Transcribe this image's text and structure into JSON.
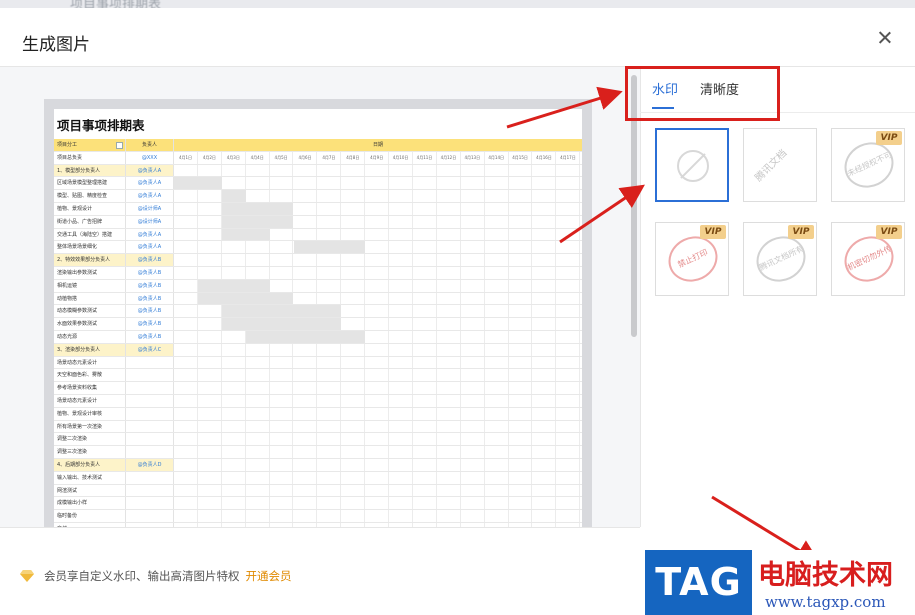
{
  "background": {
    "blurred_title": "项目事项排期表"
  },
  "dialog": {
    "title": "生成图片"
  },
  "sheet": {
    "title": "项目事项排期表",
    "header": {
      "name": "项目分工",
      "owner": "负责人",
      "dates": "日期"
    },
    "date_labels": [
      "4月1日",
      "4月2日",
      "4月3日",
      "4月4日",
      "4月5日",
      "4月6日",
      "4月7日",
      "4月8日",
      "4月9日",
      "4月10日",
      "4月11日",
      "4月12日",
      "4月13日",
      "4月14日",
      "4月15日",
      "4月16日",
      "4月17日"
    ],
    "rows": [
      {
        "name": "项目总负责",
        "owner": "@XXX",
        "section": false
      },
      {
        "name": "1、模型部分负责人",
        "owner": "@负责人A",
        "section": true
      },
      {
        "name": "区域场景模型整理搭建",
        "owner": "@负责人A",
        "section": false
      },
      {
        "name": "模型、贴图、精度检查",
        "owner": "@负责人A",
        "section": false
      },
      {
        "name": "植物、景观设计",
        "owner": "@设计师A",
        "section": false
      },
      {
        "name": "街道小品、广告招牌",
        "owner": "@设计师A",
        "section": false
      },
      {
        "name": "交通工具（海陆空）搭建",
        "owner": "@负责人A",
        "section": false
      },
      {
        "name": "整体场景场景细化",
        "owner": "@负责人A",
        "section": false
      },
      {
        "name": "2、特效效果部分负责人",
        "owner": "@负责人B",
        "section": true
      },
      {
        "name": "渲染输出参数测试",
        "owner": "@负责人B",
        "section": false
      },
      {
        "name": "相机运镜",
        "owner": "@负责人B",
        "section": false
      },
      {
        "name": "动植物搭",
        "owner": "@负责人B",
        "section": false
      },
      {
        "name": "动态模糊参数测试",
        "owner": "@负责人B",
        "section": false
      },
      {
        "name": "水面效果参数测试",
        "owner": "@负责人B",
        "section": false
      },
      {
        "name": "动态光源",
        "owner": "@负责人B",
        "section": false
      },
      {
        "name": "3、渲染部分负责人",
        "owner": "@负责人C",
        "section": true
      },
      {
        "name": "场景动态元素设计",
        "owner": "",
        "section": false
      },
      {
        "name": "天空和面色彩、雾散",
        "owner": "",
        "section": false
      },
      {
        "name": "参考场景资料收集",
        "owner": "",
        "section": false
      },
      {
        "name": "场景动态元素设计",
        "owner": "",
        "section": false
      },
      {
        "name": "植物、景观设计审核",
        "owner": "",
        "section": false
      },
      {
        "name": "所有场景第一次渲染",
        "owner": "",
        "section": false
      },
      {
        "name": "调整二次渲染",
        "owner": "",
        "section": false
      },
      {
        "name": "调整三次渲染",
        "owner": "",
        "section": false
      },
      {
        "name": "4、后期部分负责人",
        "owner": "@负责人D",
        "section": true
      },
      {
        "name": "输入输出、技术测试",
        "owner": "",
        "section": false
      },
      {
        "name": "网渲测试",
        "owner": "",
        "section": false
      },
      {
        "name": "成模输出小样",
        "owner": "",
        "section": false
      },
      {
        "name": "临时备份",
        "owner": "",
        "section": false
      },
      {
        "name": "交付",
        "owner": "",
        "section": false
      }
    ]
  },
  "panel": {
    "tabs": [
      {
        "label": "水印",
        "active": true
      },
      {
        "label": "清晰度",
        "active": false
      }
    ],
    "watermarks": [
      {
        "type": "none",
        "vip": false,
        "text": "",
        "selected": true
      },
      {
        "type": "text-tile",
        "vip": false,
        "text": "腾讯文档",
        "selected": false
      },
      {
        "type": "stamp",
        "vip": true,
        "text": "未经授权不可",
        "selected": false
      },
      {
        "type": "stamp-red",
        "vip": true,
        "text": "禁止打印",
        "selected": false
      },
      {
        "type": "stamp",
        "vip": true,
        "text": "腾讯文档所有",
        "selected": false
      },
      {
        "type": "stamp-red",
        "vip": true,
        "text": "机密切勿外传",
        "selected": false
      }
    ],
    "vip_label": "VIP"
  },
  "footer": {
    "text": "会员享自定义水印、输出高清图片特权",
    "link": "开通会员"
  },
  "logo": {
    "tag": "TAG",
    "cn": "电脑技术网",
    "url": "www.tagxp.com"
  },
  "colors": {
    "accent": "#2b6fd6",
    "annotation": "#d9201c",
    "vip_bg": "#f3cf8c",
    "link": "#e08a00"
  }
}
